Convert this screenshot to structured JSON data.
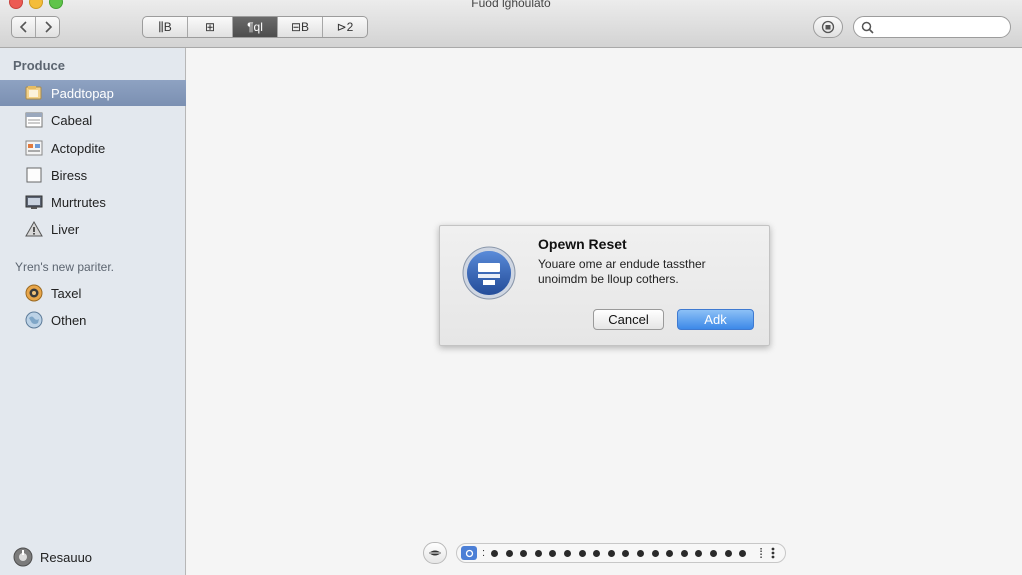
{
  "window": {
    "title": "Fuod lghoulato"
  },
  "toolbar": {
    "back_icon": "chevron-left-icon",
    "forward_icon": "chevron-right-icon",
    "view_segments": [
      {
        "label": "⫼B",
        "active": false
      },
      {
        "label": "⊞",
        "active": false
      },
      {
        "label": "¶ql",
        "active": true
      },
      {
        "label": "⊟B",
        "active": false
      },
      {
        "label": "⊳2",
        "active": false
      }
    ],
    "share_icon": "action-icon",
    "search": {
      "placeholder": "",
      "value": ""
    }
  },
  "sidebar": {
    "section1_heading": "Produce",
    "items": [
      {
        "label": "Paddtopap",
        "icon": "folder-icon",
        "selected": true
      },
      {
        "label": "Cabeal",
        "icon": "document-icon",
        "selected": false
      },
      {
        "label": "Actopdite",
        "icon": "applications-icon",
        "selected": false
      },
      {
        "label": "Biress",
        "icon": "file-icon",
        "selected": false
      },
      {
        "label": "Murtrutes",
        "icon": "monitor-icon",
        "selected": false
      },
      {
        "label": "Liver",
        "icon": "warning-icon",
        "selected": false
      }
    ],
    "section2_heading": "Yren's new pariter.",
    "items2": [
      {
        "label": "Taxel",
        "icon": "dial-icon"
      },
      {
        "label": "Othen",
        "icon": "globe-icon"
      }
    ],
    "footer_label": "Resauuo"
  },
  "dialog": {
    "title": "Opewn Reset",
    "message_line1": "Youare ome ar endude tasst⁠her",
    "message_line2": "unoimdm be lloup cothers.",
    "cancel_label": "Cancel",
    "ok_label": "Adk"
  },
  "pager": {
    "colon": ":",
    "separator": "⁞",
    "more_icon": "vertical-ellipsis-icon"
  },
  "colors": {
    "sidebar_bg": "#e3e8ee",
    "selection": "#8ea2c2",
    "primary_button": "#3d89e8"
  }
}
